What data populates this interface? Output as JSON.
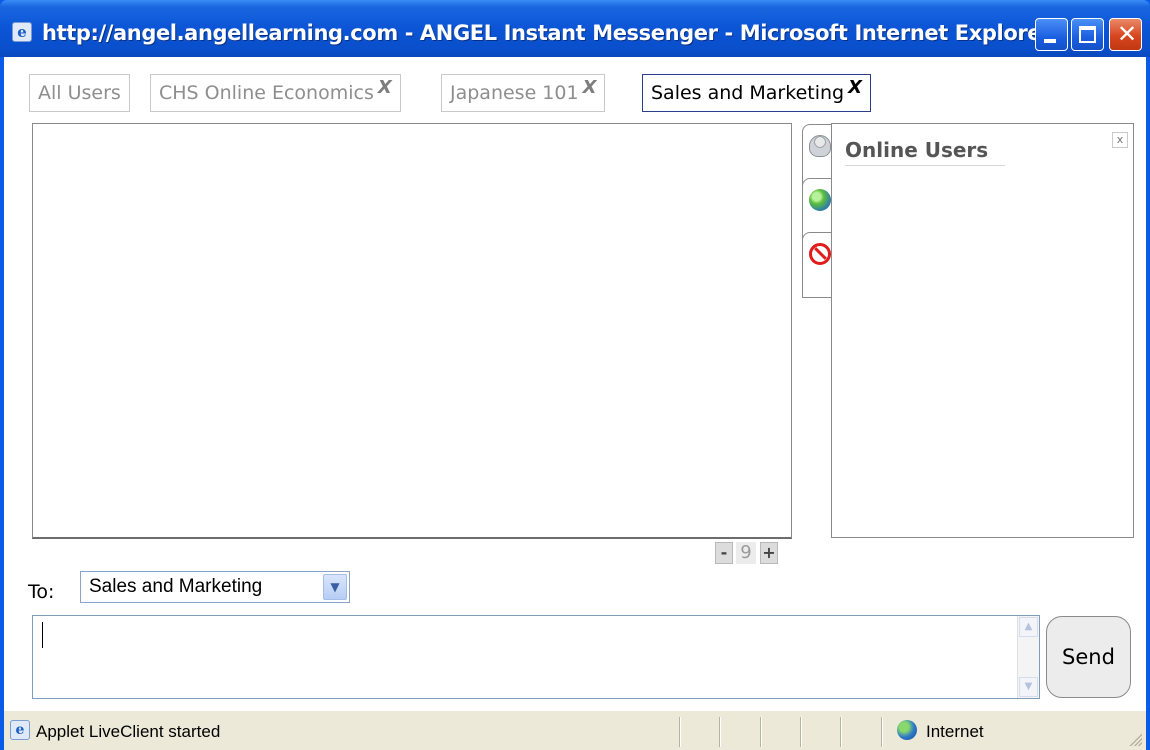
{
  "window": {
    "title": "http://angel.angellearning.com - ANGEL Instant Messenger - Microsoft Internet Explorer"
  },
  "tabs": [
    {
      "label": "All Users",
      "closable": false,
      "active": false
    },
    {
      "label": "CHS Online Economics",
      "closable": true,
      "close_label": "X",
      "active": false
    },
    {
      "label": "Japanese 101",
      "closable": true,
      "close_label": "X",
      "active": false
    },
    {
      "label": "Sales and Marketing",
      "closable": true,
      "close_label": "X",
      "active": true
    }
  ],
  "chat": {
    "font_size_value": "9",
    "decrease_label": "-",
    "increase_label": "+"
  },
  "side_panel": {
    "tabs": [
      {
        "icon": "person-icon"
      },
      {
        "icon": "globe-icon"
      },
      {
        "icon": "blocked-icon"
      }
    ],
    "title": "Online Users",
    "close_label": "x"
  },
  "compose": {
    "to_label": "To:",
    "to_selected": "Sales and Marketing",
    "message_value": "",
    "send_label": "Send"
  },
  "statusbar": {
    "status_text": "Applet LiveClient started",
    "zone_text": "Internet"
  }
}
